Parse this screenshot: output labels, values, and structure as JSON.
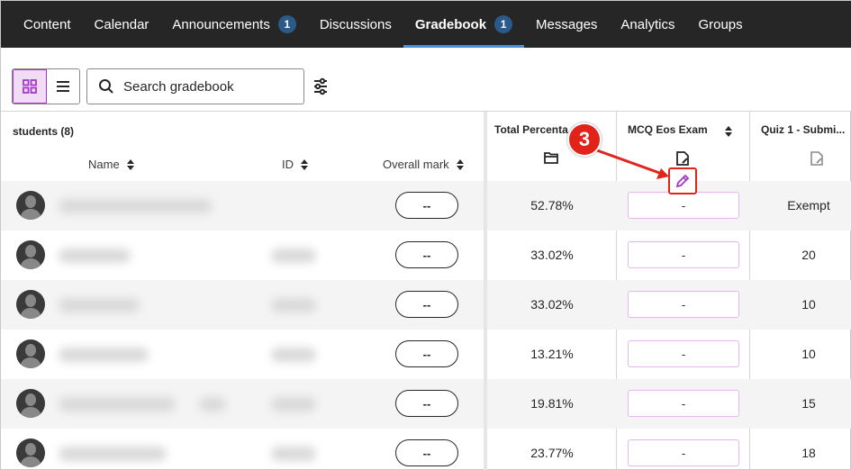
{
  "nav": {
    "tabs": [
      {
        "label": "Content"
      },
      {
        "label": "Calendar"
      },
      {
        "label": "Announcements",
        "badge": "1"
      },
      {
        "label": "Discussions"
      },
      {
        "label": "Gradebook",
        "badge": "1",
        "active": true
      },
      {
        "label": "Messages"
      },
      {
        "label": "Analytics"
      },
      {
        "label": "Groups"
      }
    ]
  },
  "toolbar": {
    "search_placeholder": "Search gradebook",
    "view_active": "grid"
  },
  "students": {
    "count_label": "students (8)",
    "headers": {
      "name": "Name",
      "id": "ID",
      "overall": "Overall mark"
    },
    "overall_value": "--"
  },
  "grade_columns": [
    {
      "title": "Total Percenta",
      "icon": "folder-icon"
    },
    {
      "title": "MCQ Eos Exam",
      "icon": "document-edit-icon",
      "sortable": true
    },
    {
      "title": "Quiz 1 - Submi...",
      "icon": "document-edit-icon"
    }
  ],
  "rows": [
    {
      "total": "52.78%",
      "mcq": "-",
      "quiz": "Exempt"
    },
    {
      "total": "33.02%",
      "mcq": "-",
      "quiz": "20"
    },
    {
      "total": "33.02%",
      "mcq": "-",
      "quiz": "10"
    },
    {
      "total": "13.21%",
      "mcq": "-",
      "quiz": "10"
    },
    {
      "total": "19.81%",
      "mcq": "-",
      "quiz": "15"
    },
    {
      "total": "23.77%",
      "mcq": "-",
      "quiz": "18"
    }
  ],
  "annotation": {
    "step": "3"
  },
  "colors": {
    "nav_bg": "#262626",
    "accent_purple": "#a637c8",
    "annotation_red": "#e2231a",
    "badge_blue": "#2a5a8a"
  }
}
